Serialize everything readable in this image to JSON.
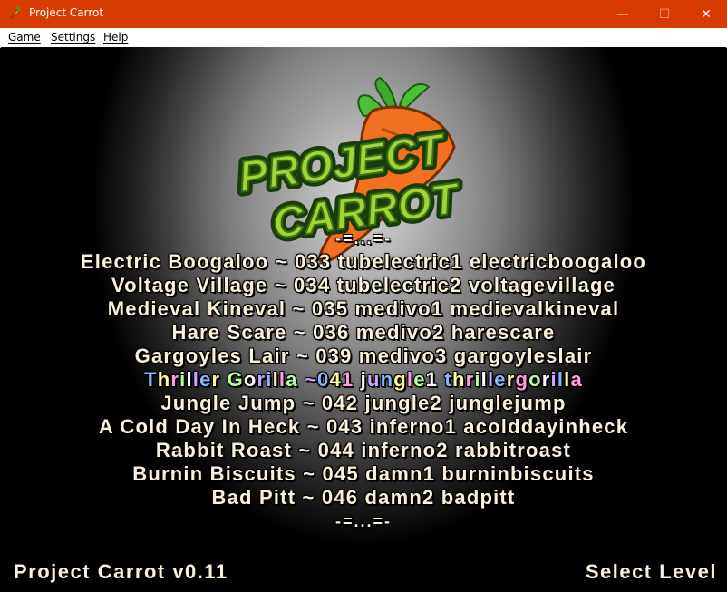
{
  "window": {
    "title": "Project Carrot",
    "minimize_glyph": "—",
    "maximize_glyph": "☐",
    "close_glyph": "✕",
    "accent": "#d83b01"
  },
  "menu": {
    "items": [
      "Game",
      "Settings",
      "Help"
    ]
  },
  "logo": {
    "line1": "PROJECT",
    "line2": "CARROT"
  },
  "level_list": {
    "separator": "-=...=-",
    "selected_index": 5,
    "levels": [
      "Electric Boogaloo ~ 033 tubelectric1 electricboogaloo",
      "Voltage Village ~ 034 tubelectric2 voltagevillage",
      "Medieval Kineval ~ 035 medivo1 medievalkineval",
      "Hare Scare ~ 036 medivo2 harescare",
      "Gargoyles Lair ~ 039 medivo3 gargoyleslair",
      "Thriller Gorilla ~041 jungle1 thrillergorilla",
      "Jungle Jump ~ 042 jungle2 junglejump",
      "A Cold Day In Heck ~ 043 inferno1 acolddayinheck",
      "Rabbit Roast ~ 044 inferno2 rabbitroast",
      "Burnin Biscuits ~ 045 damn1 burninbiscuits",
      "Bad Pitt ~ 046 damn2 badpitt"
    ]
  },
  "footer": {
    "version": "Project Carrot v0.11",
    "mode": "Select Level"
  }
}
